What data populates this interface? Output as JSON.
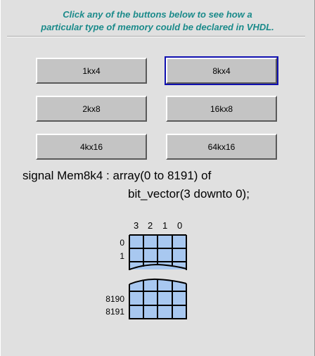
{
  "instructions": {
    "line1": "Click any of the buttons below to see how a",
    "line2": "particular type of memory could be declared in VHDL."
  },
  "buttons": [
    {
      "label": "1kx4"
    },
    {
      "label": "8kx4",
      "selected": true
    },
    {
      "label": "2kx8"
    },
    {
      "label": "16kx8"
    },
    {
      "label": "4kx16"
    },
    {
      "label": "64kx16"
    }
  ],
  "declaration": {
    "line1": "signal Mem8k4 : array(0 to 8191) of",
    "line2": "bit_vector(3 downto 0);"
  },
  "diagram": {
    "column_headers": [
      "3",
      "2",
      "1",
      "0"
    ],
    "top_rows": [
      "0",
      "1"
    ],
    "bottom_rows": [
      "8190",
      "8191"
    ],
    "cell_color": "#a8c8f0"
  },
  "colors": {
    "instruction_text": "#1a8a8a",
    "selected_outline": "#1010b0",
    "background": "#e0e0e0"
  }
}
